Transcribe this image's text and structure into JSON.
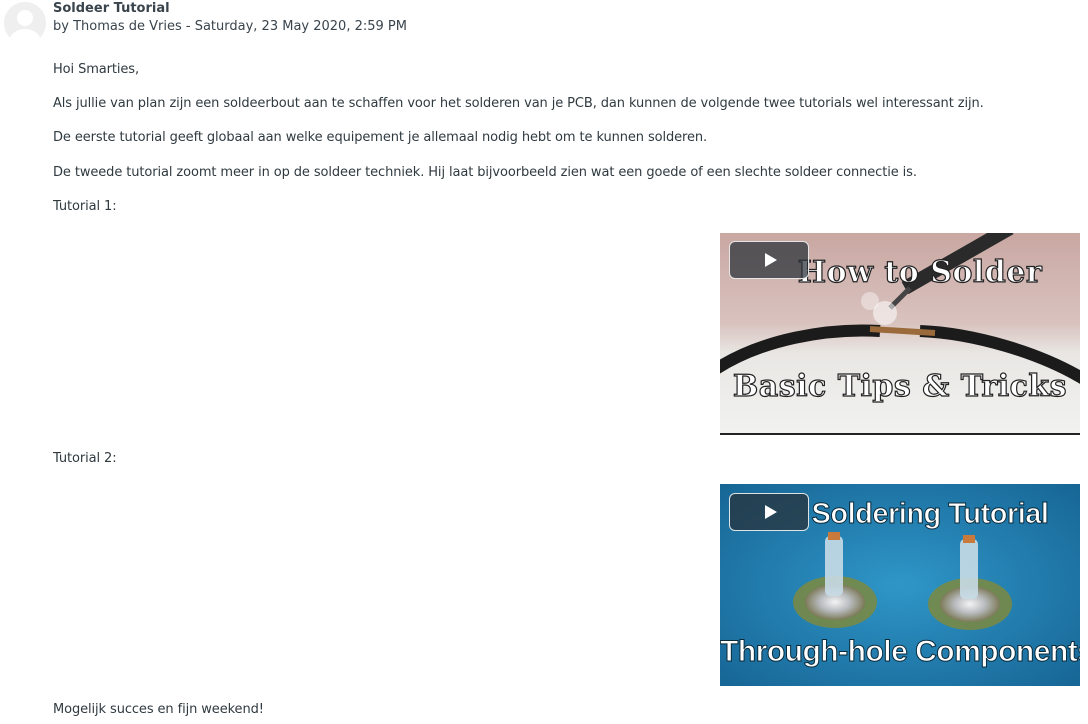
{
  "post": {
    "title": "Soldeer Tutorial",
    "meta": "by Thomas de Vries - Saturday, 23 May 2020, 2:59 PM"
  },
  "body": {
    "greeting": "Hoi Smarties,",
    "paragraph_1": "Als jullie van plan zijn een soldeerbout aan te schaffen voor het solderen van je PCB, dan kunnen de volgende twee tutorials wel interessant zijn.",
    "paragraph_2": "De eerste tutorial geeft globaal aan welke equipement je allemaal nodig hebt om te kunnen solderen.",
    "paragraph_3": "De tweede tutorial zoomt meer in op de soldeer techniek. Hij laat bijvoorbeeld zien wat een goede of een slechte soldeer connectie is.",
    "tutorial_1_label": "Tutorial 1:",
    "tutorial_2_label": "Tutorial 2:",
    "closing": "Mogelijk succes en fijn weekend!"
  },
  "videos": [
    {
      "line_1": "How to Solder",
      "line_2": "Basic Tips & Tricks",
      "play_icon": "play-icon"
    },
    {
      "line_1": "Soldering Tutorial",
      "line_2": "Through-hole Components",
      "play_icon": "play-icon"
    }
  ],
  "colors": {
    "text": "#2f3a40",
    "title": "#39444d",
    "video2_background": "#1f7fb3"
  }
}
